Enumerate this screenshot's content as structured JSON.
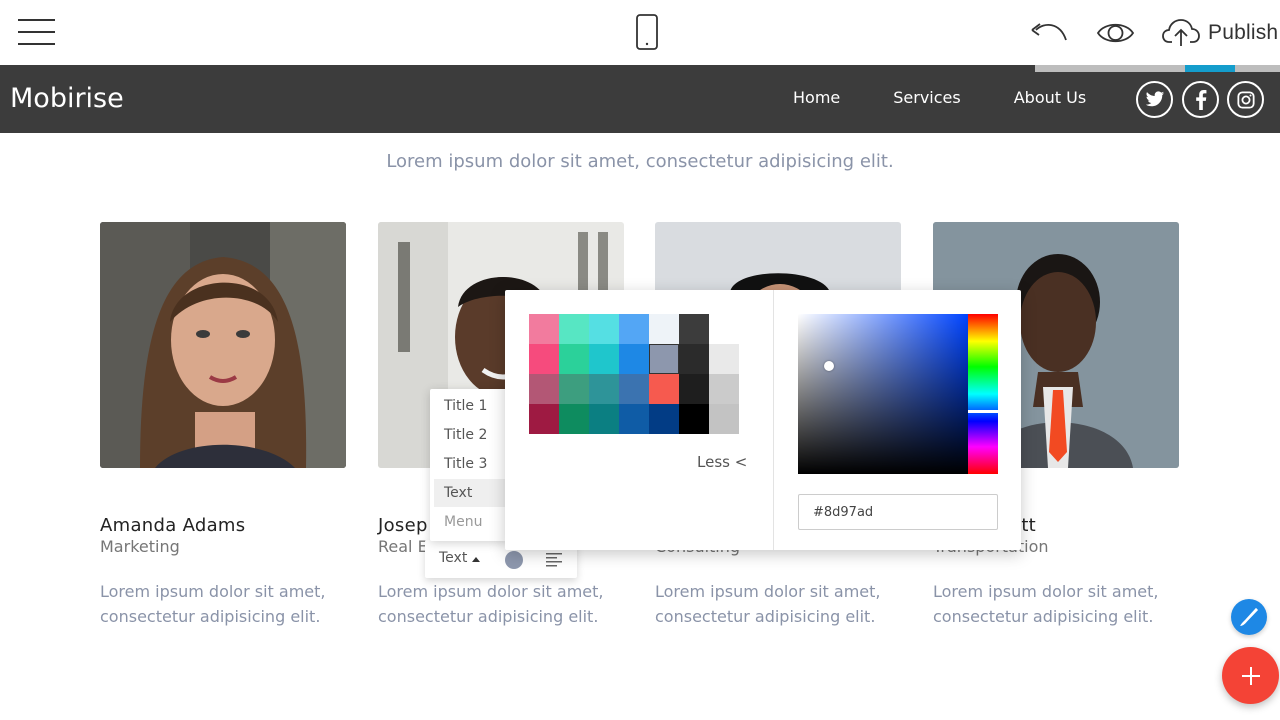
{
  "topbar": {
    "publish_label": "Publish"
  },
  "navbar": {
    "brand": "Mobirise",
    "links": [
      "Home",
      "Services",
      "About Us"
    ]
  },
  "section": {
    "subtitle": "Lorem ipsum dolor sit amet, consectetur adipisicing elit."
  },
  "cards": [
    {
      "name": "Amanda Adams",
      "role": "Marketing",
      "desc": "Lorem ipsum dolor sit amet, consectetur adipisicing elit."
    },
    {
      "name": "Josep",
      "role": "Real E",
      "desc": "Lorem ipsum dolor sit amet, consectetur adipisicing elit."
    },
    {
      "name": "",
      "role": "Consulting",
      "desc": "Lorem ipsum dolor sit amet, consectetur adipisicing elit."
    },
    {
      "name": "ott",
      "role": "Transportation",
      "desc": "Lorem ipsum dolor sit amet, consectetur adipisicing elit."
    }
  ],
  "style_dropdown": {
    "items": [
      "Title 1",
      "Title 2",
      "Title 3",
      "Text",
      "Menu"
    ],
    "active": "Text"
  },
  "text_toolbar": {
    "style_label": "Text",
    "swatch_color": "#8d97ad"
  },
  "color_picker": {
    "less_label": "Less <",
    "hex_value": "#8d97ad",
    "palette": [
      [
        "#f27b9e",
        "#57e6c3",
        "#55dfe3",
        "#53a6f5",
        "#eef3f8",
        "#3c3c3c",
        null
      ],
      [
        "#f64b7d",
        "#2bd19a",
        "#1fc6cc",
        "#1e88e5",
        "#8d97ad",
        "#2b2b2b",
        "#e9e9e9"
      ],
      [
        "#b35775",
        "#3d9e7f",
        "#2e9499",
        "#3b73b0",
        "#f65a4f",
        "#1e1e1e",
        "#cbcbcb"
      ],
      [
        "#9e1a42",
        "#0e8c5f",
        "#0b7f82",
        "#0f5ca6",
        "#023c85",
        "#000000",
        "#c3c3c3"
      ]
    ],
    "selected": "#8d97ad"
  },
  "colors": {
    "navbar_bg": "#3c3c3c",
    "accent_blue": "#1e88e5",
    "accent_red": "#f44336",
    "muted_text": "#8a93a8"
  }
}
